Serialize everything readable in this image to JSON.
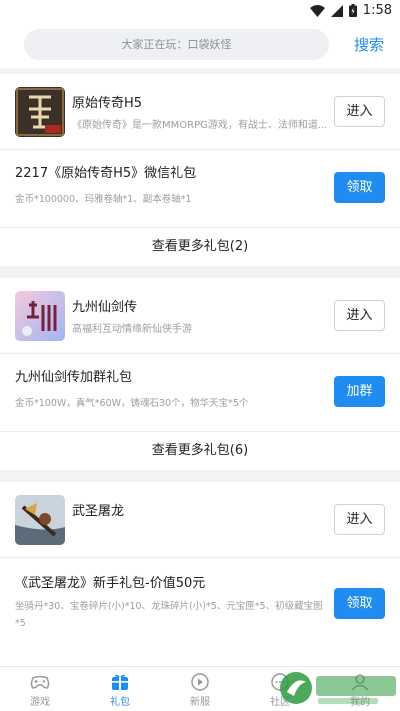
{
  "status": {
    "time": "1:58"
  },
  "search": {
    "placeholder": "大家正在玩：口袋妖怪",
    "button": "搜索"
  },
  "sections": [
    {
      "game_name": "原始传奇H5",
      "game_desc": "《原始传奇》是一款MMORPG游戏，有战士、法师和道...",
      "enter_label": "进入",
      "gift_title": "2217《原始传奇H5》微信礼包",
      "gift_desc": "金币*100000、玛雅卷轴*1、副本卷轴*1",
      "gift_button": "领取",
      "more_label": "查看更多礼包(2)"
    },
    {
      "game_name": "九州仙剑传",
      "game_desc": "高福利互动情缘新仙侠手游",
      "enter_label": "进入",
      "gift_title": "九州仙剑传加群礼包",
      "gift_desc": "金币*100W，真气*60W，铸魂石30个，物华天宝*5个",
      "gift_button": "加群",
      "more_label": "查看更多礼包(6)"
    },
    {
      "game_name": "武圣屠龙",
      "enter_label": "进入",
      "gift_title": "《武圣屠龙》新手礼包-价值50元",
      "gift_desc": "坐骑丹*30、宝卷碎片(小)*10、龙珠碎片(小)*5、元宝匣*5、初级藏宝图*5",
      "gift_button": "领取"
    }
  ],
  "tabs": [
    {
      "label": "游戏"
    },
    {
      "label": "礼包"
    },
    {
      "label": "新服"
    },
    {
      "label": "社区"
    },
    {
      "label": "我的"
    }
  ],
  "colors": {
    "accent": "#1e8cf0",
    "background": "#f2f3f5"
  }
}
